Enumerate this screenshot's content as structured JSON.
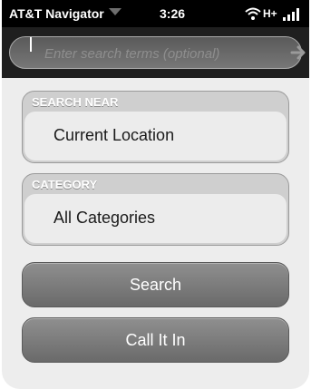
{
  "status_bar": {
    "app_name": "AT&T Navigator",
    "time": "3:26",
    "network": "H+"
  },
  "search": {
    "placeholder": "Enter search terms (optional)",
    "value": ""
  },
  "search_near": {
    "label": "SEARCH NEAR",
    "value": "Current Location"
  },
  "category": {
    "label": "CATEGORY",
    "value": "All Categories"
  },
  "buttons": {
    "search_label": "Search",
    "call_label": "Call It In"
  },
  "icons": {
    "app_menu": "chevron-down-icon",
    "wifi": "wifi-icon",
    "signal": "signal-bars-icon",
    "go": "arrow-right-icon"
  }
}
